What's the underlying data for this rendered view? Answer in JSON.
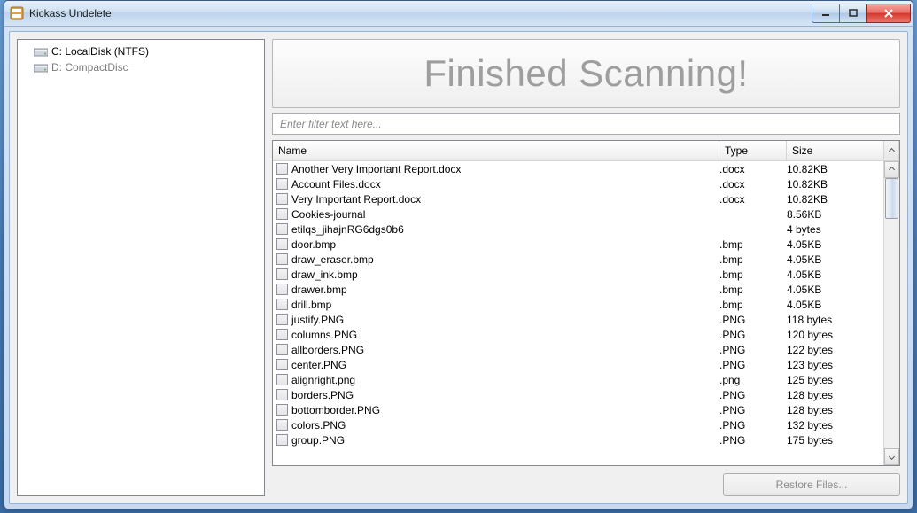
{
  "window": {
    "title": "Kickass Undelete"
  },
  "sidebar": {
    "drives": [
      {
        "label": "C: LocalDisk (NTFS)",
        "dim": false
      },
      {
        "label": "D: CompactDisc",
        "dim": true
      }
    ]
  },
  "banner": {
    "text": "Finished Scanning!"
  },
  "filter": {
    "placeholder": "Enter filter text here..."
  },
  "columns": {
    "name": "Name",
    "type": "Type",
    "size": "Size"
  },
  "files": [
    {
      "name": "Another Very Important Report.docx",
      "type": ".docx",
      "size": "10.82KB"
    },
    {
      "name": "Account Files.docx",
      "type": ".docx",
      "size": "10.82KB"
    },
    {
      "name": "Very Important Report.docx",
      "type": ".docx",
      "size": "10.82KB"
    },
    {
      "name": "Cookies-journal",
      "type": "",
      "size": "8.56KB"
    },
    {
      "name": "etilqs_jihajnRG6dgs0b6",
      "type": "",
      "size": "4 bytes"
    },
    {
      "name": "door.bmp",
      "type": ".bmp",
      "size": "4.05KB"
    },
    {
      "name": "draw_eraser.bmp",
      "type": ".bmp",
      "size": "4.05KB"
    },
    {
      "name": "draw_ink.bmp",
      "type": ".bmp",
      "size": "4.05KB"
    },
    {
      "name": "drawer.bmp",
      "type": ".bmp",
      "size": "4.05KB"
    },
    {
      "name": "drill.bmp",
      "type": ".bmp",
      "size": "4.05KB"
    },
    {
      "name": "justify.PNG",
      "type": ".PNG",
      "size": "118 bytes"
    },
    {
      "name": "columns.PNG",
      "type": ".PNG",
      "size": "120 bytes"
    },
    {
      "name": "allborders.PNG",
      "type": ".PNG",
      "size": "122 bytes"
    },
    {
      "name": "center.PNG",
      "type": ".PNG",
      "size": "123 bytes"
    },
    {
      "name": "alignright.png",
      "type": ".png",
      "size": "125 bytes"
    },
    {
      "name": "borders.PNG",
      "type": ".PNG",
      "size": "128 bytes"
    },
    {
      "name": "bottomborder.PNG",
      "type": ".PNG",
      "size": "128 bytes"
    },
    {
      "name": "colors.PNG",
      "type": ".PNG",
      "size": "132 bytes"
    },
    {
      "name": "group.PNG",
      "type": ".PNG",
      "size": "175 bytes"
    }
  ],
  "footer": {
    "restore_label": "Restore Files..."
  }
}
